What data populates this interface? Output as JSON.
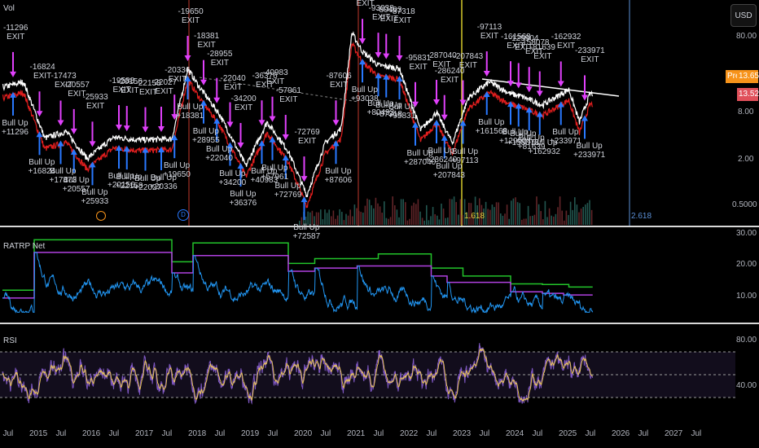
{
  "panes": {
    "main": {
      "title": "Vol",
      "currency_button": "USD",
      "price_ticks": [
        "80.00",
        "8.00",
        "2.00",
        "0.5000"
      ],
      "pre_label": "Pre",
      "pre_price": "13.65",
      "last_price": "13.52",
      "fib_labels": [
        "1.618",
        "2.618"
      ],
      "marker_d": "D"
    },
    "ratrp": {
      "title": "RATRP Net",
      "ticks": [
        "30.00",
        "20.00",
        "10.00"
      ]
    },
    "rsi": {
      "title": "RSI",
      "ticks": [
        "80.00",
        "40.00"
      ]
    }
  },
  "time_axis": [
    "Jul",
    "2015",
    "Jul",
    "2016",
    "Jul",
    "2017",
    "Jul",
    "2018",
    "Jul",
    "2019",
    "Jul",
    "2020",
    "Jul",
    "2021",
    "Jul",
    "2022",
    "Jul",
    "2023",
    "Jul",
    "2024",
    "Jul",
    "2025",
    "Jul",
    "2026",
    "Jul",
    "2027",
    "Jul"
  ],
  "colors": {
    "bg": "#000000",
    "price": "#ffffff",
    "stop": "#e01e1e",
    "exit": "#e040fb",
    "bull": "#2979ff",
    "green": "#22c32a",
    "purple": "#b040e0",
    "blue": "#2196f3",
    "rsi": "#7e57c2",
    "rsi_ma": "#e8c35a",
    "pre": "#f7931a",
    "last": "#e0505a"
  },
  "chart_data": [
    {
      "type": "line",
      "title": "Price (log scale)",
      "ylabel": "USD",
      "yscale": "log",
      "ylim": [
        0.4,
        90
      ],
      "xlim": [
        2014.4,
        2027.9
      ],
      "price": {
        "t": [
          2014.4,
          2014.8,
          2015.2,
          2015.6,
          2016.0,
          2016.5,
          2017.0,
          2017.6,
          2017.9,
          2018.1,
          2018.5,
          2019.0,
          2019.4,
          2019.8,
          2020.15,
          2020.5,
          2020.8,
          2021.0,
          2021.2,
          2021.5,
          2021.9,
          2022.3,
          2022.6,
          2022.9,
          2023.2,
          2023.6,
          2024.0,
          2024.2,
          2024.6,
          2025.1,
          2025.3,
          2025.5
        ],
        "v": [
          17,
          20,
          3.7,
          4.5,
          2.0,
          3.8,
          3.5,
          3.6,
          30,
          18,
          7.6,
          1.6,
          6,
          2.5,
          0.66,
          3.2,
          5,
          88,
          50,
          33,
          30,
          4.7,
          8,
          3.2,
          12.4,
          20,
          14,
          13,
          10,
          16,
          6,
          14
        ]
      },
      "signals": [
        {
          "t": 2014.6,
          "exit": "-11296",
          "bull": "+11296"
        },
        {
          "t": 2015.1,
          "exit": "-16824",
          "bull": "+16824"
        },
        {
          "t": 2015.5,
          "exit": "-17473",
          "bull": "+17473"
        },
        {
          "t": 2015.75,
          "exit": "-20557",
          "bull": "+20557"
        },
        {
          "t": 2016.1,
          "exit": "-25933",
          "bull": "+25933"
        },
        {
          "t": 2016.6,
          "exit": "-19588",
          "bull": "+20156"
        },
        {
          "t": 2016.75,
          "exit": "-20156",
          "bull": "+22158"
        },
        {
          "t": 2017.1,
          "exit": "-22158",
          "bull": "+22027"
        },
        {
          "t": 2017.4,
          "exit": "-22027",
          "bull": "+20336"
        },
        {
          "t": 2017.65,
          "exit": "-20336",
          "bull": "+19650"
        },
        {
          "t": 2017.9,
          "exit": "-19650",
          "bull": "+18381"
        },
        {
          "t": 2018.2,
          "exit": "-18381",
          "bull": "+28955"
        },
        {
          "t": 2018.45,
          "exit": "-28955",
          "bull": "+22040"
        },
        {
          "t": 2018.7,
          "exit": "-22040",
          "bull": "+34200"
        },
        {
          "t": 2018.9,
          "exit": "-34200",
          "bull": "+36376"
        },
        {
          "t": 2019.3,
          "exit": "-36376",
          "bull": "+40983"
        },
        {
          "t": 2019.5,
          "exit": "-40983",
          "bull": "+57961"
        },
        {
          "t": 2019.75,
          "exit": "-57961",
          "bull": "+72769"
        },
        {
          "t": 2020.1,
          "exit": "-72769",
          "bull": "+72587"
        },
        {
          "t": 2020.7,
          "exit": "-87606",
          "bull": "+87606"
        },
        {
          "t": 2021.2,
          "exit": "-72587",
          "bull": "+93038"
        },
        {
          "t": 2021.5,
          "exit": "-93038",
          "bull": "+80493"
        },
        {
          "t": 2021.65,
          "exit": "-80493",
          "bull": "+87318"
        },
        {
          "t": 2021.9,
          "exit": "-87318",
          "bull": "+95831"
        },
        {
          "t": 2022.2,
          "exit": "-95831",
          "bull": "+287040"
        },
        {
          "t": 2022.6,
          "exit": "-287040",
          "bull": "+286240"
        },
        {
          "t": 2022.75,
          "exit": "-286240",
          "bull": "+207843"
        },
        {
          "t": 2023.1,
          "exit": "-207843",
          "bull": "+97113"
        },
        {
          "t": 2023.55,
          "exit": "-97113",
          "bull": "+161568"
        },
        {
          "t": 2024.0,
          "exit": "-161568",
          "bull": "+129904"
        },
        {
          "t": 2024.15,
          "exit": "-129904",
          "bull": "+158078"
        },
        {
          "t": 2024.35,
          "exit": "-158078",
          "bull": "+81639"
        },
        {
          "t": 2024.55,
          "exit": "-81639",
          "bull": "+162932"
        },
        {
          "t": 2024.95,
          "exit": "-162932",
          "bull": "+233971"
        },
        {
          "t": 2025.4,
          "exit": "-233971",
          "bull": "+233971"
        }
      ],
      "exit_word": "EXIT",
      "bull_word": "Bull Up"
    },
    {
      "type": "line",
      "title": "RATRP Net",
      "ylim": [
        3,
        33
      ],
      "green_steps": {
        "t": [
          2014.4,
          2015.0,
          2017.6,
          2018.0,
          2019.8,
          2020.3,
          2021.5,
          2022.5,
          2022.8,
          2023.1,
          2024.0,
          2024.6,
          2025.1,
          2025.55
        ],
        "v": [
          12,
          28,
          21,
          27,
          20.5,
          22,
          23.5,
          19,
          19,
          16.5,
          14,
          13.8,
          13,
          13
        ]
      },
      "purple_steps": {
        "t": [
          2014.4,
          2015.0,
          2017.6,
          2018.0,
          2019.8,
          2020.3,
          2021.1,
          2022.5,
          2022.8,
          2024.0,
          2024.6,
          2025.0,
          2025.55
        ],
        "v": [
          9.5,
          24,
          17.5,
          23,
          18,
          19,
          19.7,
          16.5,
          14.5,
          11.5,
          11,
          10.5,
          10.5
        ]
      },
      "blue_range": [
        5,
        25
      ]
    },
    {
      "type": "line",
      "title": "RSI",
      "ylim": [
        20,
        90
      ],
      "bands": [
        30,
        50,
        70
      ],
      "range": [
        25,
        85
      ]
    }
  ]
}
